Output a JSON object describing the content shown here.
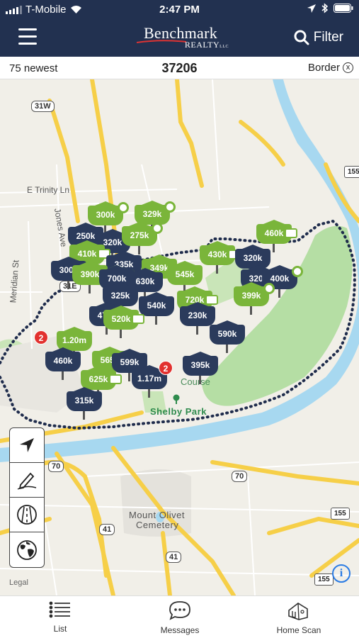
{
  "status": {
    "carrier": "T-Mobile",
    "time": "2:47 PM"
  },
  "header": {
    "logo_main": "Benchmark",
    "logo_sub": "REALTY",
    "logo_llc": "LLC",
    "filter_label": "Filter"
  },
  "infobar": {
    "left": "75 newest",
    "center": "37206",
    "right": "Border"
  },
  "map": {
    "labels": {
      "trinity": "E Trinity Ln",
      "jones": "Jones Ave",
      "meridian": "Meridian St",
      "cemetery_1": "Mount Olivet",
      "cemetery_2": "Cemetery",
      "course": "Course",
      "legal": "Legal"
    },
    "park": "Shelby Park",
    "shields": {
      "us31w": "31W",
      "us31e": "31E",
      "us70_a": "70",
      "us70_b": "70",
      "us41_a": "41",
      "us41_b": "41",
      "i155_a": "155",
      "i155_b": "155",
      "i155_c": "155"
    },
    "markers": [
      {
        "label": "300k",
        "color": "green"
      },
      {
        "label": "329k",
        "color": "green"
      },
      {
        "label": "250k",
        "color": "navy"
      },
      {
        "label": "320k",
        "color": "navy"
      },
      {
        "label": "275k",
        "color": "green"
      },
      {
        "label": "460k",
        "color": "green"
      },
      {
        "label": "410k",
        "color": "green"
      },
      {
        "label": "335k",
        "color": "navy"
      },
      {
        "label": "325k",
        "color": "green"
      },
      {
        "label": "349k",
        "color": "green"
      },
      {
        "label": "430k",
        "color": "green"
      },
      {
        "label": "320k",
        "color": "navy"
      },
      {
        "label": "300k",
        "color": "navy"
      },
      {
        "label": "390k",
        "color": "green"
      },
      {
        "label": "700k",
        "color": "navy"
      },
      {
        "label": "630k",
        "color": "navy"
      },
      {
        "label": "545k",
        "color": "green"
      },
      {
        "label": "320k",
        "color": "navy"
      },
      {
        "label": "400k",
        "color": "navy"
      },
      {
        "label": "325k",
        "color": "navy"
      },
      {
        "label": "720k",
        "color": "green"
      },
      {
        "label": "399k",
        "color": "green"
      },
      {
        "label": "540k",
        "color": "navy"
      },
      {
        "label": "230k",
        "color": "navy"
      },
      {
        "label": "475k",
        "color": "navy"
      },
      {
        "label": "520k",
        "color": "green"
      },
      {
        "label": "590k",
        "color": "navy"
      },
      {
        "label": "1.20m",
        "color": "green"
      },
      {
        "label": "460k",
        "color": "navy"
      },
      {
        "label": "565k",
        "color": "green"
      },
      {
        "label": "599k",
        "color": "navy"
      },
      {
        "label": "395k",
        "color": "navy"
      },
      {
        "label": "625k",
        "color": "green"
      },
      {
        "label": "1.17m",
        "color": "navy"
      },
      {
        "label": "315k",
        "color": "navy"
      }
    ],
    "clusters": [
      "2",
      "2"
    ]
  },
  "tools": {
    "locate": "navigation-arrow-icon",
    "draw": "pencil-icon",
    "road": "road-icon",
    "globe": "globe-icon"
  },
  "tabs": {
    "list": "List",
    "messages": "Messages",
    "home_scan": "Home Scan"
  }
}
